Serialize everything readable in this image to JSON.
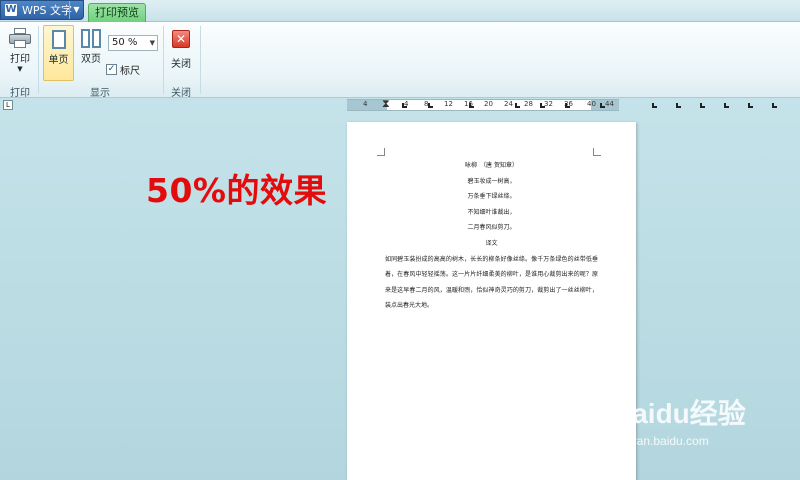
{
  "app": {
    "name": "WPS 文字",
    "logo_letter": "W"
  },
  "tabs": {
    "active": "打印预览"
  },
  "ribbon": {
    "print_label": "打印",
    "print_group": "打印",
    "single_page": "单页",
    "double_page": "双页",
    "zoom": "50 %",
    "ruler_label": "标尺",
    "ruler_checked": "✓",
    "display_group": "显示",
    "close_label": "关闭",
    "close_group": "关闭"
  },
  "ruler": {
    "ticks": [
      "4",
      "4",
      "8",
      "12",
      "16",
      "20",
      "24",
      "28",
      "32",
      "36",
      "40",
      "44"
    ]
  },
  "document": {
    "lines": [
      "咏柳　（唐 贺知章）",
      "碧玉妆成一树高，",
      "万条垂下绿丝绦。",
      "不知细叶谁裁出，",
      "二月春风似剪刀。",
      "译文"
    ],
    "paragraph": "如同碧玉装扮成的高高的树木，长长的柳条好像丝绦。像千万条绿色的丝带低垂着，在春风中轻轻摇荡。这一片片纤细柔美的柳叶，是谁用心裁剪出来的呢？原来是这早春二月的风，温暖和煦，恰似神奇灵巧的剪刀，裁剪出了一丝丝柳叶，装点出春光大地。"
  },
  "overlay": {
    "caption": "50%的效果"
  },
  "watermark": {
    "brand": "Baidu经验",
    "url": "jingyan.baidu.com"
  },
  "colors": {
    "caption": "#e30b0b",
    "tab_active": "#6ccf7c",
    "app_button": "#2f63a5"
  }
}
